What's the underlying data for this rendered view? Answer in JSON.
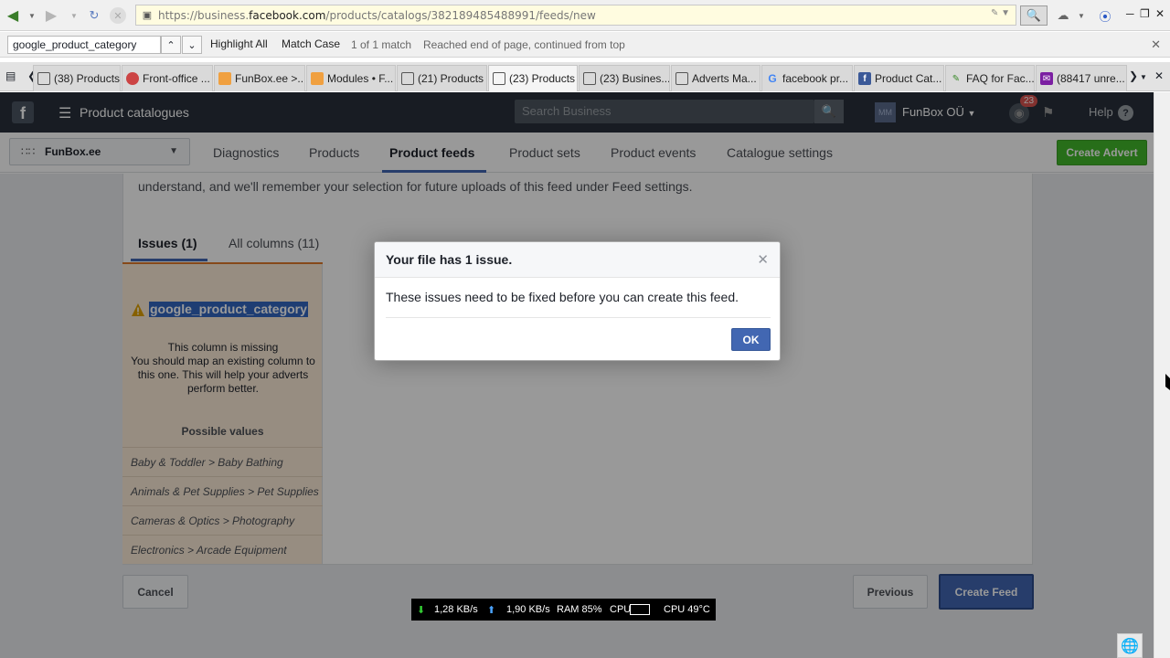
{
  "browser": {
    "url_prefix": "https://business.",
    "url_host": "facebook.com",
    "url_path": "/products/catalogs/382189485488991/feeds/new",
    "find_bar": {
      "query": "google_product_category",
      "highlight_all": "Highlight All",
      "match_case": "Match Case",
      "match_count": "1 of 1 match",
      "status": "Reached end of page, continued from top"
    },
    "tabs": [
      {
        "label": "(38) Products",
        "icon": "page-icon"
      },
      {
        "label": "Front-office ...",
        "icon": "gauge-icon"
      },
      {
        "label": "FunBox.ee >...",
        "icon": "funbox-icon"
      },
      {
        "label": "Modules • F...",
        "icon": "funbox-icon"
      },
      {
        "label": "(21) Products",
        "icon": "page-icon"
      },
      {
        "label": "(23) Products",
        "icon": "page-icon"
      },
      {
        "label": "(23) Busines...",
        "icon": "page-icon"
      },
      {
        "label": "Adverts Ma...",
        "icon": "page-icon"
      },
      {
        "label": "facebook pr...",
        "icon": "google-icon"
      },
      {
        "label": "Product Cat...",
        "icon": "facebook-icon"
      },
      {
        "label": "FAQ for Fac...",
        "icon": "tag-icon"
      },
      {
        "label": "(88417 unre...",
        "icon": "mail-icon"
      }
    ]
  },
  "fb": {
    "header": {
      "title": "Product catalogues",
      "search_placeholder": "Search Business",
      "avatar_initials": "MM",
      "account_name": "FunBox OÜ",
      "notification_count": "23",
      "help": "Help"
    },
    "subnav": {
      "business": "FunBox.ee",
      "tabs": [
        "Diagnostics",
        "Products",
        "Product feeds",
        "Product sets",
        "Product events",
        "Catalogue settings"
      ],
      "active_tab": "Product feeds",
      "create_advert": "Create Advert"
    },
    "intro_text": "understand, and we'll remember your selection for future uploads of this feed under Feed settings.",
    "issue_tabs": {
      "issues": "Issues (1)",
      "all_columns": "All columns (11)"
    },
    "issue": {
      "column": "google_product_category",
      "missing_line1": "This column is missing",
      "missing_line2": "You should map an existing column to this one. This will help your adverts perform better.",
      "possible_values_title": "Possible values",
      "possible_values": [
        "Baby & Toddler > Baby Bathing",
        "Animals & Pet Supplies > Pet Supplies",
        "Cameras & Optics > Photography",
        "Electronics > Arcade Equipment"
      ]
    },
    "buttons": {
      "cancel": "Cancel",
      "previous": "Previous",
      "create_feed": "Create Feed"
    },
    "modal": {
      "title": "Your file has 1 issue.",
      "body": "These issues need to be fixed before you can create this feed.",
      "ok": "OK"
    }
  },
  "sys_monitor": {
    "down": "1,28 KB/s",
    "up": "1,90 KB/s",
    "ram": "RAM 85%",
    "cpu_label": "CPU",
    "cpu_temp": "CPU 49°C"
  }
}
